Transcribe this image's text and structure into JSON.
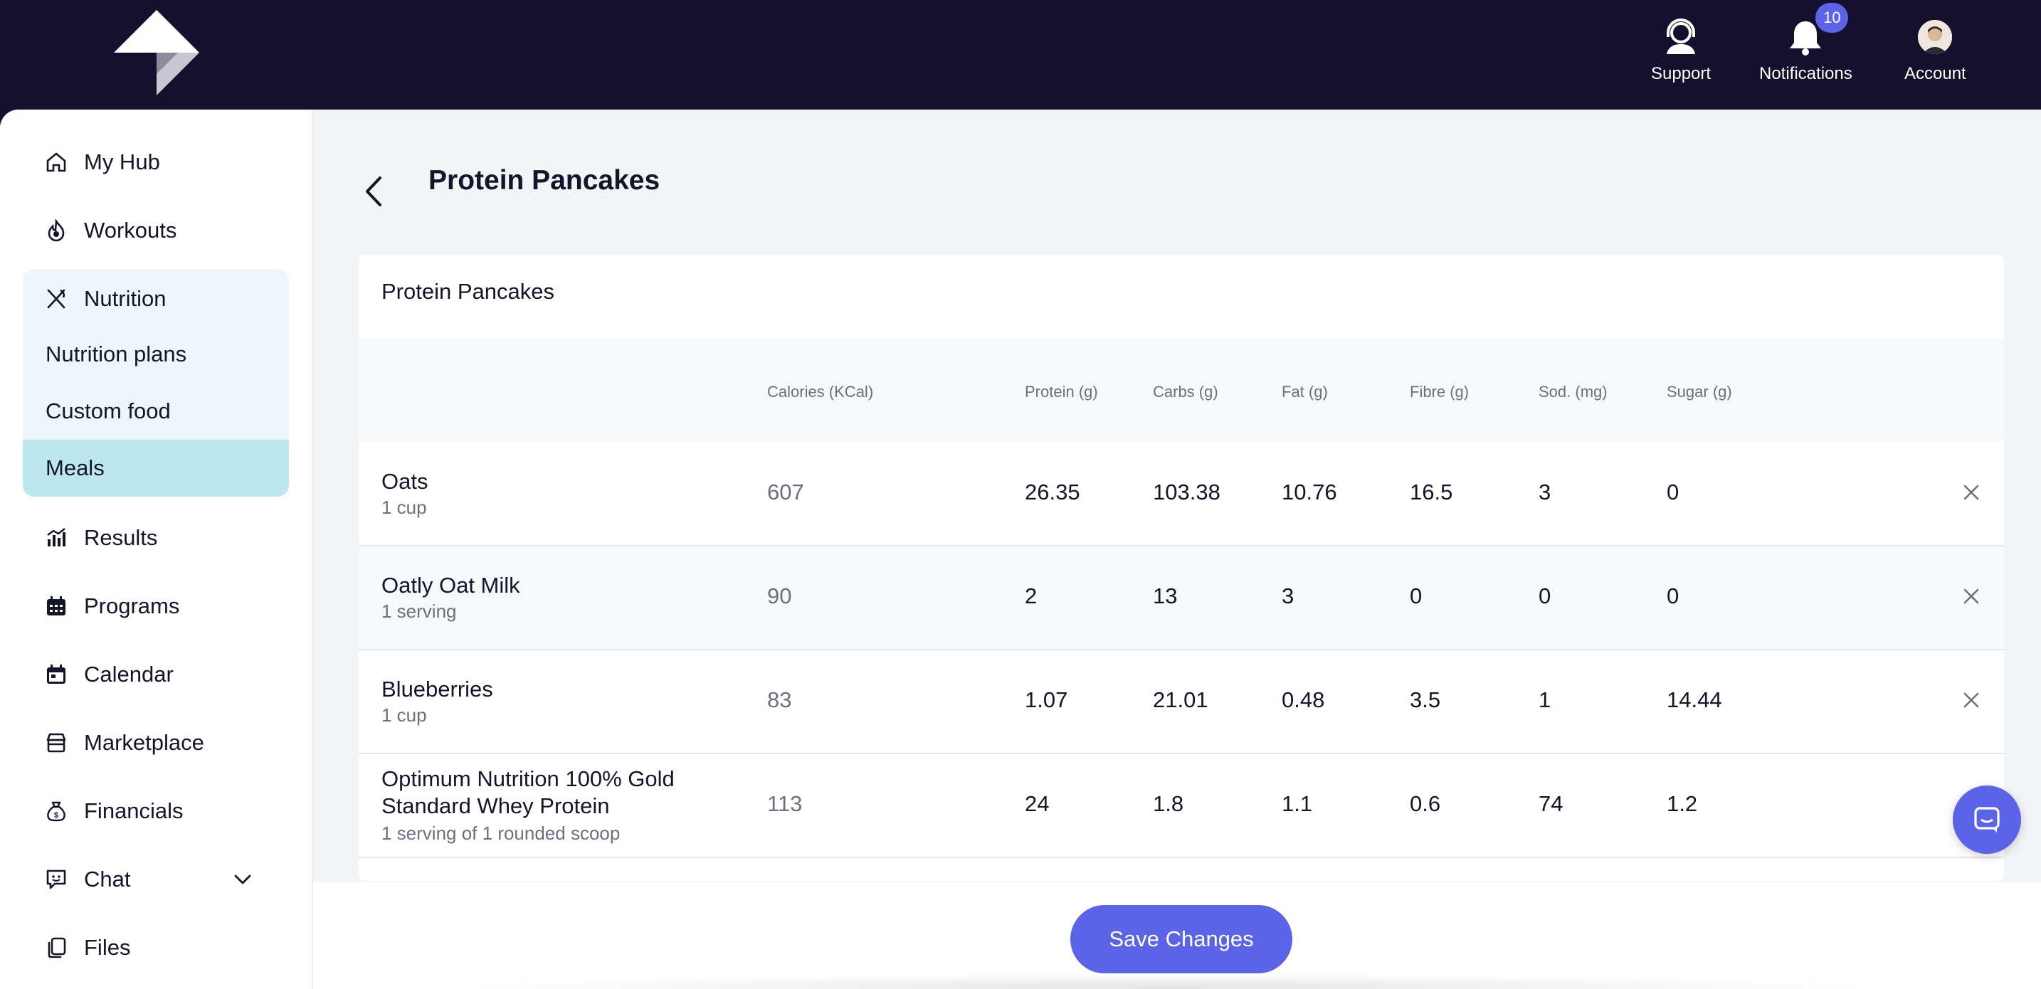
{
  "header": {
    "support_label": "Support",
    "notifications_label": "Notifications",
    "notifications_count": "10",
    "account_label": "Account"
  },
  "sidebar": {
    "items": [
      {
        "label": "My Hub",
        "icon": "home-icon"
      },
      {
        "label": "Workouts",
        "icon": "flame-icon"
      },
      {
        "label": "Nutrition",
        "icon": "utensils-icon"
      },
      {
        "label": "Results",
        "icon": "chart-icon"
      },
      {
        "label": "Programs",
        "icon": "calendar-grid-icon"
      },
      {
        "label": "Calendar",
        "icon": "calendar-icon"
      },
      {
        "label": "Marketplace",
        "icon": "store-icon"
      },
      {
        "label": "Financials",
        "icon": "money-bag-icon"
      },
      {
        "label": "Chat",
        "icon": "chat-icon"
      },
      {
        "label": "Files",
        "icon": "files-icon"
      }
    ],
    "nutrition_sub": [
      "Nutrition plans",
      "Custom food",
      "Meals"
    ],
    "active_sub": "Meals"
  },
  "main": {
    "title": "Protein Pancakes",
    "card_title": "Protein Pancakes",
    "columns": [
      "Calories (KCal)",
      "Protein (g)",
      "Carbs (g)",
      "Fat (g)",
      "Fibre (g)",
      "Sod. (mg)",
      "Sugar (g)"
    ],
    "rows": [
      {
        "name": "Oats",
        "serving": "1 cup",
        "calories": "607",
        "protein": "26.35",
        "carbs": "103.38",
        "fat": "10.76",
        "fibre": "16.5",
        "sodium": "3",
        "sugar": "0"
      },
      {
        "name": "Oatly Oat Milk",
        "serving": "1 serving",
        "calories": "90",
        "protein": "2",
        "carbs": "13",
        "fat": "3",
        "fibre": "0",
        "sodium": "0",
        "sugar": "0"
      },
      {
        "name": "Blueberries",
        "serving": "1 cup",
        "calories": "83",
        "protein": "1.07",
        "carbs": "21.01",
        "fat": "0.48",
        "fibre": "3.5",
        "sodium": "1",
        "sugar": "14.44"
      },
      {
        "name": "Optimum Nutrition 100% Gold Standard Whey Protein",
        "serving": "1 serving of 1 rounded scoop",
        "calories": "113",
        "protein": "24",
        "carbs": "1.8",
        "fat": "1.1",
        "fibre": "0.6",
        "sodium": "74",
        "sugar": "1.2"
      }
    ]
  },
  "footer": {
    "save_label": "Save Changes"
  },
  "colors": {
    "topbar": "#15102e",
    "accent": "#5b63e6",
    "active_nav": "#bde7ee",
    "nav_group": "#eff6f9"
  }
}
